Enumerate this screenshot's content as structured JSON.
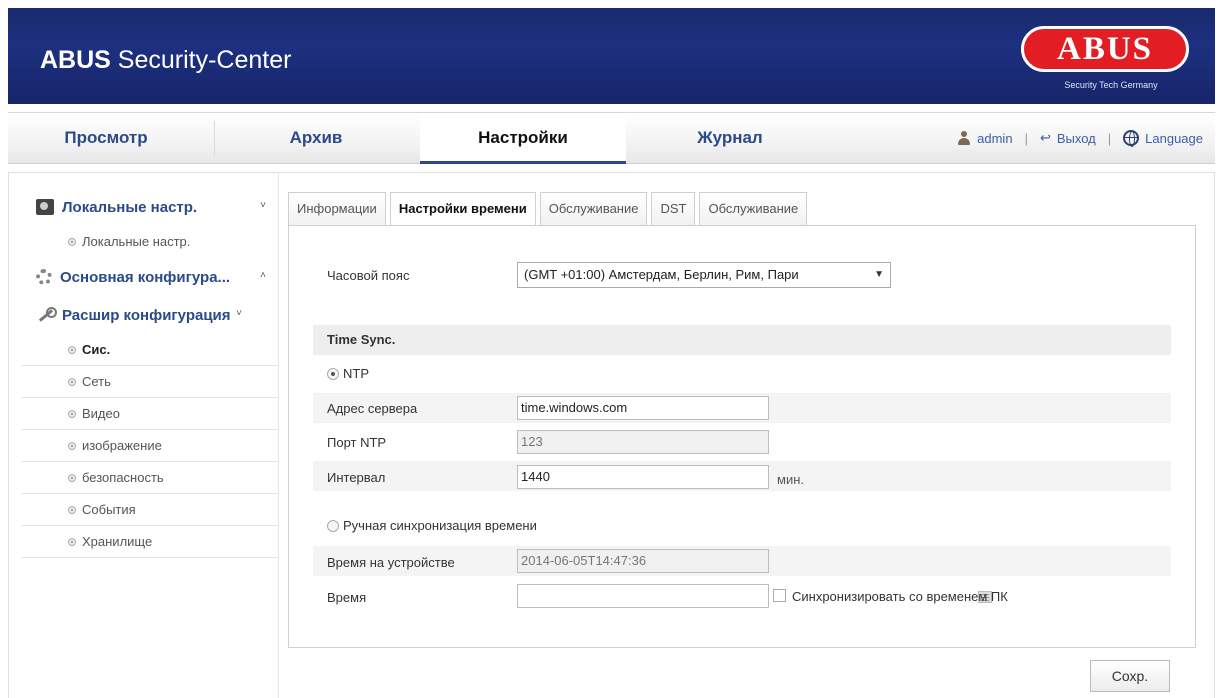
{
  "header": {
    "title_bold": "ABUS",
    "title_rest": " Security-Center",
    "logo_text": "ABUS",
    "logo_sub": "Security Tech Germany"
  },
  "nav": {
    "tabs": [
      "Просмотр",
      "Архив",
      "Настройки",
      "Журнал"
    ],
    "active": "Настройки",
    "user": "admin",
    "logout": "Выход",
    "language": "Language"
  },
  "sidebar": {
    "groups": [
      {
        "label": "Локальные настр.",
        "chevron": "˅",
        "icon": "camera-icon"
      },
      {
        "label": "Основная конфигура...",
        "chevron": "˄",
        "icon": "gear-icon"
      },
      {
        "label": "Расшир конфигурация",
        "chevron": "˅",
        "icon": "wrench-icon"
      }
    ],
    "local_items": [
      "Локальные настр."
    ],
    "advanced_items": [
      "Сис.",
      "Сеть",
      "Видео",
      "изображение",
      "безопасность",
      "События",
      "Хранилище"
    ],
    "active_item": "Сис."
  },
  "subtabs": [
    "Информации",
    "Настройки времени",
    "Обслуживание",
    "DST",
    "Обслуживание"
  ],
  "form": {
    "timezone_label": "Часовой пояс",
    "timezone_value": "(GMT +01:00) Амстердам, Берлин, Рим, Пари",
    "section_title": "Time Sync.",
    "ntp_label": "NTP",
    "server_label": "Адрес сервера",
    "server_value": "time.windows.com",
    "port_label": "Порт NTP",
    "port_value": "123",
    "interval_label": "Интервал",
    "interval_value": "1440",
    "interval_unit": "мин.",
    "manual_label": "Ручная синхронизация времени",
    "device_time_label": "Время на устройстве",
    "device_time_value": "2014-06-05T14:47:36",
    "time_label": "Время",
    "time_value": "",
    "sync_pc_label": "Синхронизировать со временем ПК",
    "save_label": "Сохр."
  }
}
